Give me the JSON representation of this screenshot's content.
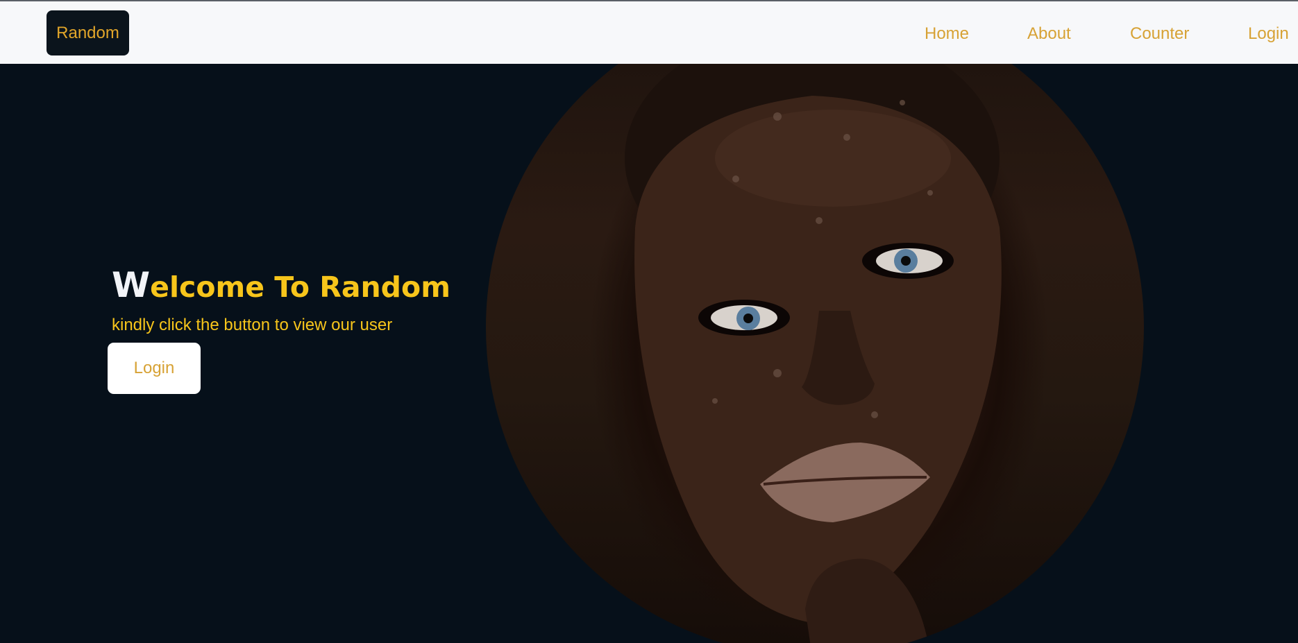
{
  "navbar": {
    "brand": "Random",
    "links": [
      "Home",
      "About",
      "Counter",
      "Login"
    ]
  },
  "hero": {
    "headline_first_letter": "W",
    "headline_rest": "elcome To Random",
    "subtitle": "kindly click the button to view our user",
    "button_label": "Login"
  },
  "colors": {
    "background": "#06101a",
    "navbar_background": "#f7f8fa",
    "accent_gold": "#d7a235",
    "headline_yellow": "#f7c51b"
  }
}
